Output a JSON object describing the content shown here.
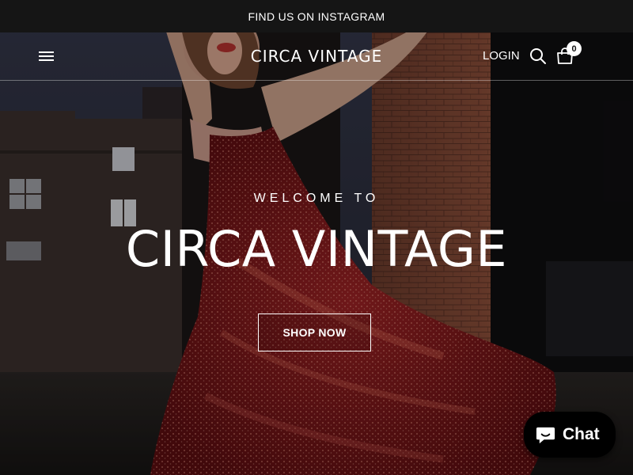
{
  "announcement": {
    "text": "FIND US ON INSTAGRAM"
  },
  "header": {
    "logo": "CIRCA VINTAGE",
    "login_label": "LOGIN",
    "cart_count": "0",
    "icons": {
      "menu": "hamburger-menu-icon",
      "search": "search-icon",
      "cart": "shopping-bag-icon"
    }
  },
  "hero": {
    "kicker": "WELCOME TO",
    "title": "CIRCA VINTAGE",
    "cta_label": "SHOP NOW"
  },
  "chat": {
    "label": "Chat",
    "icon": "chat-bubble-icon"
  },
  "colors": {
    "text": "#ffffff",
    "announcement_bg": "#151515",
    "chat_bg": "#000000",
    "dress_red": "#8e1a1c"
  }
}
